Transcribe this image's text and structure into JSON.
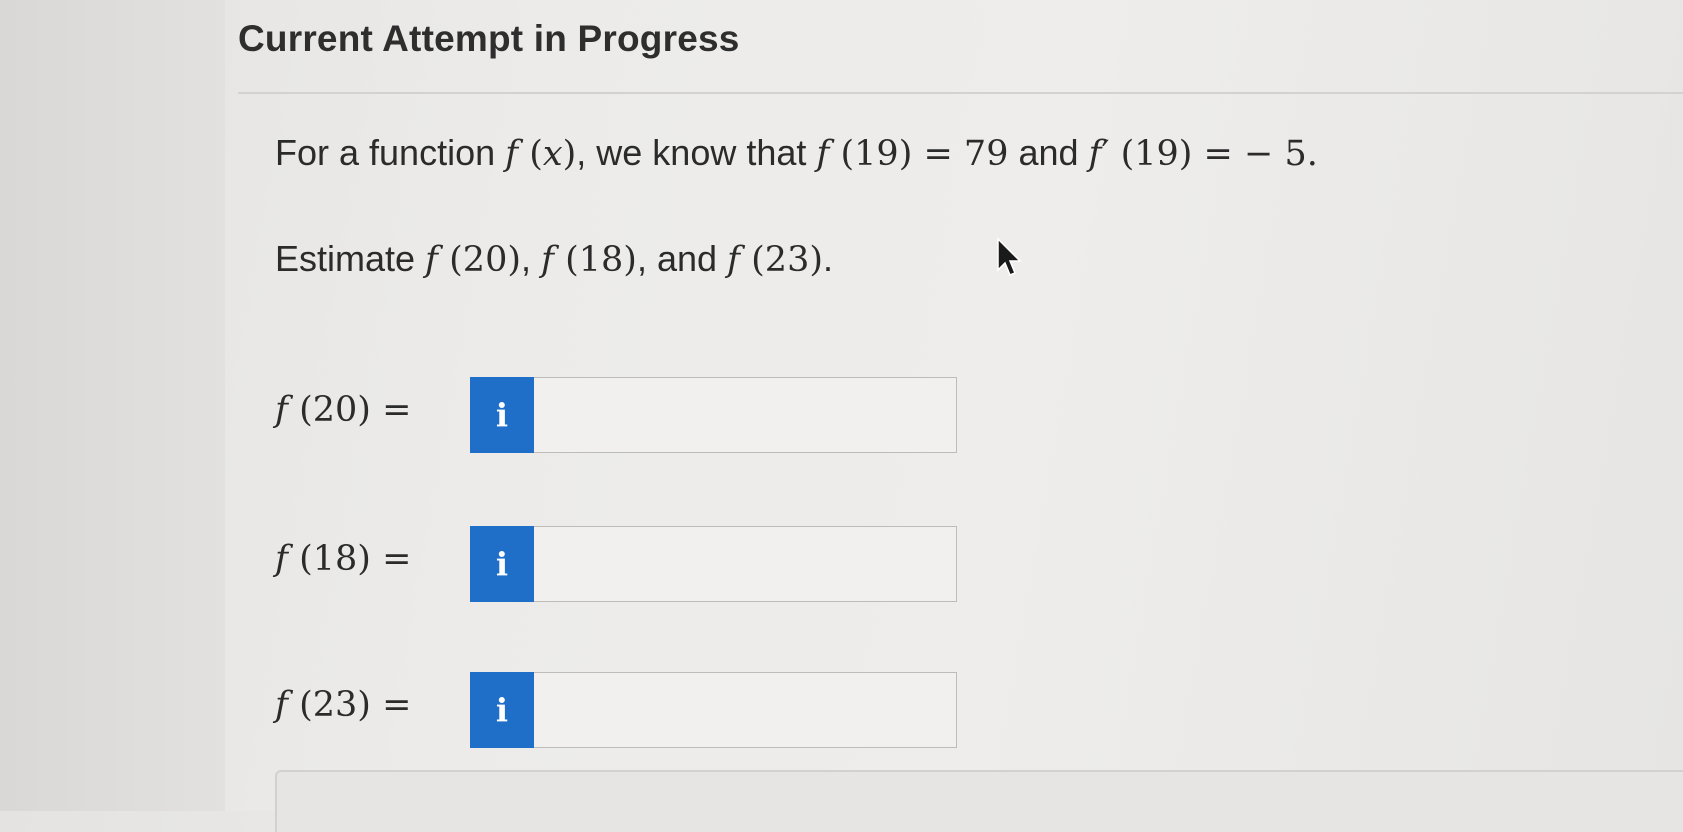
{
  "header": {
    "title": "Current Attempt in Progress"
  },
  "question": {
    "line1": {
      "text_start": "For a function ",
      "fx_f": "f",
      "fx_rest": " (",
      "fx_x": "x",
      "fx_close": ")",
      "text_mid1": ", we know that ",
      "f19_f": "f",
      "f19_rest": " (19) = 79",
      "text_and": " and ",
      "fp19_f": "f",
      "fp19_rest": "′ (19) = − 5."
    },
    "line2": {
      "text_start": "Estimate ",
      "a_f": "f",
      "a_rest": " (20)",
      "sep1": ", ",
      "b_f": "f",
      "b_rest": " (18)",
      "sep2": ", and ",
      "c_f": "f",
      "c_rest": " (23)",
      "end": "."
    }
  },
  "answers": [
    {
      "label_f": "f",
      "label_rest": " (20)  =",
      "value": ""
    },
    {
      "label_f": "f",
      "label_rest": " (18)  =",
      "value": ""
    },
    {
      "label_f": "f",
      "label_rest": " (23)  =",
      "value": ""
    }
  ],
  "info_button": {
    "glyph": "i",
    "color": "#1f6fc9"
  },
  "icons": {
    "info": "info-icon",
    "cursor": "mouse-cursor-icon"
  }
}
